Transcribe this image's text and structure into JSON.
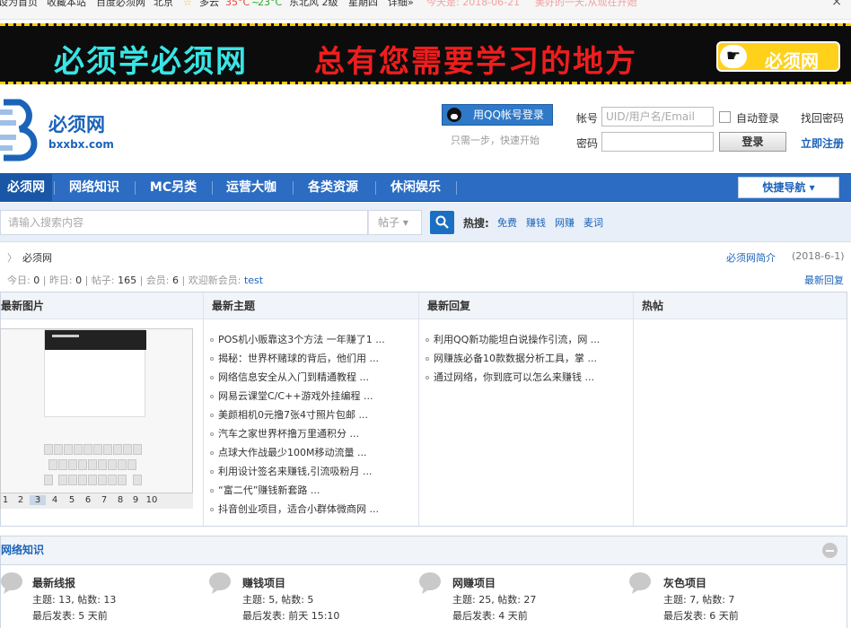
{
  "topbar": {
    "set_home": "设为首页",
    "favorite": "收藏本站",
    "site_name": "百度必须网",
    "city": "北京",
    "weather": "多云",
    "temp_high": "35°C",
    "temp_sep": "~",
    "temp_low": "23°C",
    "wind": "东北风 2级",
    "weekday": "星期四",
    "detail": "详细»",
    "today": "今天是: 2018-06-21",
    "greeting": "美好的一天,从现在开始",
    "close": "×"
  },
  "banner": {
    "slogan_left": "必须学必须网",
    "slogan_right": "总有您需要学习的地方",
    "badge": "必须网"
  },
  "header": {
    "logo_name": "必须网",
    "logo_domain": "bxxbx.com",
    "qq_login": "用QQ帐号登录",
    "qq_hint": "只需一步，快速开始",
    "account_label": "帐号",
    "account_placeholder": "UID/用户名/Email",
    "password_label": "密码",
    "auto_login": "自动登录",
    "login_button": "登录",
    "forgot": "找回密码",
    "register": "立即注册"
  },
  "nav": {
    "items": [
      "必须网",
      "网络知识",
      "MC另类",
      "运营大咖",
      "各类资源",
      "休闲娱乐"
    ],
    "quick_nav": "快捷导航 ▾"
  },
  "search": {
    "placeholder": "请输入搜索内容",
    "type": "帖子 ▾",
    "hot_label": "热搜:",
    "hot": [
      "免费",
      "赚钱",
      "网赚",
      "麦词"
    ]
  },
  "crumb": {
    "arrow": "〉",
    "current": "必须网",
    "intro_link": "必须网简介",
    "intro_date": "(2018-6-1)"
  },
  "stats": {
    "today_label": "今日:",
    "today": "0",
    "yesterday_label": "昨日:",
    "yesterday": "0",
    "posts_label": "帖子:",
    "posts": "165",
    "members_label": "会员:",
    "members": "6",
    "welcome_label": "欢迎新会员:",
    "new_member": "test",
    "sep": "|",
    "latest_reply": "最新回复"
  },
  "panels": {
    "heads": [
      "最新图片",
      "最新主题",
      "最新回复",
      "热帖"
    ],
    "pager": [
      "1",
      "2",
      "3",
      "4",
      "5",
      "6",
      "7",
      "8",
      "9",
      "10"
    ],
    "topics": [
      "POS机小贩靠这3个方法 一年赚了1 ...",
      "揭秘：世界杯赌球的背后，他们用 ...",
      "网络信息安全从入门到精通教程 ...",
      "网易云课堂C/C++游戏外挂编程 ...",
      "美颜相机0元撸7张4寸照片包邮 ...",
      "汽车之家世界杯撸万里通积分 ...",
      "点球大作战最少100M移动流量 ...",
      "利用设计签名来赚钱,引流吸粉月 ...",
      "“富二代”赚钱新套路 ...",
      "抖音创业项目，适合小群体微商网 ..."
    ],
    "replies": [
      "利用QQ新功能坦白说操作引流，网 ...",
      "网赚族必备10款数据分析工具，掌 ...",
      "通过网络，你到底可以怎么来赚钱 ..."
    ]
  },
  "forum_section": {
    "title": "网络知识",
    "forums": [
      {
        "name": "最新线报",
        "stat": "主题: 13, 帖数: 13",
        "last": "最后发表: 5 天前"
      },
      {
        "name": "赚钱项目",
        "stat": "主题: 5, 帖数: 5",
        "last": "最后发表: 前天 15:10"
      },
      {
        "name": "网赚项目",
        "stat": "主题: 25, 帖数: 27",
        "last": "最后发表: 4 天前"
      },
      {
        "name": "灰色项目",
        "stat": "主题: 7, 帖数: 7",
        "last": "最后发表: 6 天前"
      }
    ]
  },
  "colors": {
    "brand_blue": "#1b63b9",
    "nav_blue": "#2c6cc2",
    "banner_cyan": "#39e5e5",
    "banner_red": "#f01d1d",
    "badge_yellow": "#ffd11a"
  },
  "icons": [
    "qq-icon",
    "search-icon",
    "hand-pointer-icon",
    "speech-bubble-icon",
    "collapse-icon",
    "close-icon",
    "weather-icon"
  ]
}
